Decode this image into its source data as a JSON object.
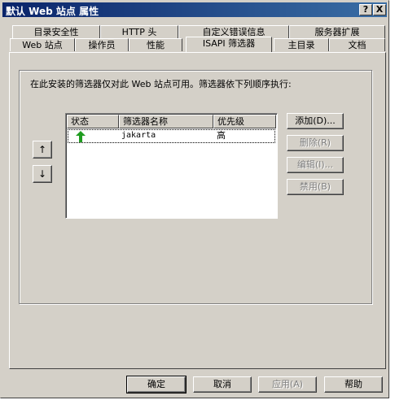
{
  "window": {
    "title": "默认 Web 站点 属性",
    "help_button": "?",
    "close_button": "X"
  },
  "tabs_row1": [
    {
      "label": "目录安全性"
    },
    {
      "label": "HTTP 头"
    },
    {
      "label": "自定义错误信息"
    },
    {
      "label": "服务器扩展"
    }
  ],
  "tabs_row2": [
    {
      "label": "Web 站点"
    },
    {
      "label": "操作员"
    },
    {
      "label": "性能"
    },
    {
      "label": "ISAPI 筛选器",
      "active": true
    },
    {
      "label": "主目录"
    },
    {
      "label": "文档"
    }
  ],
  "panel": {
    "description": "在此安装的筛选器仅对此 Web 站点可用。筛选器依下列顺序执行:",
    "move_up_glyph": "↑",
    "move_down_glyph": "↓",
    "list": {
      "columns": [
        "状态",
        "筛选器名称",
        "优先级"
      ],
      "rows": [
        {
          "status_icon": "green-up-arrow-icon",
          "name": "jakarta",
          "priority": "高"
        }
      ]
    },
    "buttons": {
      "add": "添加(D)...",
      "remove": "删除(R)",
      "edit": "编辑(I)...",
      "disable": "禁用(B)"
    }
  },
  "footer": {
    "ok": "确定",
    "cancel": "取消",
    "apply": "应用(A)",
    "help": "帮助"
  },
  "colors": {
    "dialog_face": "#d4d0c8",
    "title_bar": "#0a246a",
    "status_icon": "#1f9c1f"
  }
}
